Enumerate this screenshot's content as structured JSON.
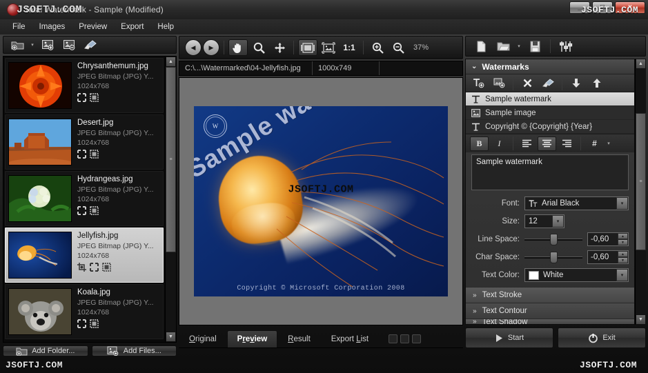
{
  "window": {
    "title": "Total Watermark - Sample (Modified)",
    "minimize": "_",
    "maximize": "□",
    "close": "x"
  },
  "watermark_overlay": {
    "title_stamp": "JSOFTJ.COM",
    "topright_stamp": "JSOFTJ.COM",
    "leftbottom_stamp": "JSOFTJ.COM",
    "rightbottom_stamp": "JSOFTJ.COM",
    "preview_stamp": "JSOFTJ.COM"
  },
  "menu": {
    "items": [
      {
        "label": "File"
      },
      {
        "label": "Images"
      },
      {
        "label": "Preview"
      },
      {
        "label": "Export"
      },
      {
        "label": "Help"
      }
    ]
  },
  "left_panel": {
    "toolbar": [
      {
        "name": "add-folder-icon",
        "tip": "Add Folder"
      },
      {
        "name": "chevron-down-icon",
        "tip": "More"
      },
      {
        "name": "add-image-icon",
        "tip": "Add Images"
      },
      {
        "name": "remove-image-icon",
        "tip": "Remove Images"
      },
      {
        "name": "clear-list-icon",
        "tip": "Clear List"
      }
    ],
    "files": [
      {
        "name": "Chrysanthemum.jpg",
        "type": "JPEG Bitmap (JPG) Y...",
        "dimensions": "1024x768",
        "selected": false,
        "badges": [
          "resize-icon",
          "frame-icon"
        ]
      },
      {
        "name": "Desert.jpg",
        "type": "JPEG Bitmap (JPG) Y...",
        "dimensions": "1024x768",
        "selected": false,
        "badges": [
          "resize-icon",
          "frame-icon"
        ]
      },
      {
        "name": "Hydrangeas.jpg",
        "type": "JPEG Bitmap (JPG) Y...",
        "dimensions": "1024x768",
        "selected": false,
        "badges": [
          "resize-icon",
          "frame-icon"
        ]
      },
      {
        "name": "Jellyfish.jpg",
        "type": "JPEG Bitmap (JPG) Y...",
        "dimensions": "1024x768",
        "selected": true,
        "badges": [
          "crop-icon",
          "resize-icon",
          "frame-icon"
        ]
      },
      {
        "name": "Koala.jpg",
        "type": "JPEG Bitmap (JPG) Y...",
        "dimensions": "1024x768",
        "selected": false,
        "badges": [
          "resize-icon",
          "frame-icon"
        ]
      }
    ],
    "add_folder_label": "Add Folder...",
    "add_files_label": "Add Files..."
  },
  "center_panel": {
    "toolbar": {
      "prev": "◀",
      "next": "▶",
      "hand": "hand-icon",
      "magnify": "magnifier-icon",
      "move": "move-icon",
      "fit_window": "fit-window-icon",
      "fit_image": "fit-image-icon",
      "actual_size": "1:1",
      "zoom_in": "zoom-in-icon",
      "zoom_out": "zoom-out-icon",
      "zoom_level": "37%"
    },
    "path": "C:\\...\\Watermarked\\04-Jellyfish.jpg",
    "image_size": "1000x749",
    "preview_image": {
      "diagonal_watermark": "Sample watermark",
      "copyright_text": "Copyright © Microsoft Corporation 2008",
      "stamp_letter": "W"
    },
    "tabs": [
      {
        "label": "Original",
        "accel": "O",
        "active": false
      },
      {
        "label": "Preview",
        "accel": "P",
        "active": true
      },
      {
        "label": "Result",
        "accel": "R",
        "active": false
      },
      {
        "label": "Export List",
        "accel": "L",
        "active": false
      }
    ]
  },
  "right_panel": {
    "toolbar": [
      {
        "name": "new-preset-icon"
      },
      {
        "name": "open-preset-icon"
      },
      {
        "name": "chevron-down-icon"
      },
      {
        "name": "save-preset-icon"
      },
      {
        "name": "settings-sliders-icon"
      }
    ],
    "section_title": "Watermarks",
    "list_toolbar": [
      {
        "name": "add-text-watermark-icon"
      },
      {
        "name": "add-image-watermark-icon"
      },
      {
        "name": "delete-watermark-icon"
      },
      {
        "name": "clear-watermarks-icon"
      },
      {
        "name": "move-down-icon"
      },
      {
        "name": "move-up-icon"
      }
    ],
    "watermarks": [
      {
        "icon": "text-watermark-icon",
        "label": "Sample watermark",
        "selected": true
      },
      {
        "icon": "image-watermark-icon",
        "label": "Sample image",
        "selected": false
      },
      {
        "icon": "text-watermark-icon",
        "label": "Copyright © {Copyright} {Year}",
        "selected": false
      }
    ],
    "format_toolbar": {
      "bold": "B",
      "italic": "I",
      "align_left": "align-left-icon",
      "align_center": "align-center-icon",
      "align_right": "align-right-icon",
      "variable": "#",
      "variable_caret": "▾",
      "bold_active": true,
      "align_center_active": true
    },
    "text_value": "Sample watermark",
    "fields": {
      "font_label": "Font:",
      "font_value": "Arial Black",
      "size_label": "Size:",
      "size_value": "12",
      "line_space_label": "Line Space:",
      "line_space_value": "-0,60",
      "char_space_label": "Char Space:",
      "char_space_value": "-0,60",
      "text_color_label": "Text Color:",
      "text_color_value": "White",
      "text_color_hex": "#ffffff"
    },
    "collapsed_sections": [
      {
        "label": "Text Stroke"
      },
      {
        "label": "Text Contour"
      },
      {
        "label": "Text Shadow"
      }
    ],
    "start_label": "Start",
    "exit_label": "Exit"
  }
}
